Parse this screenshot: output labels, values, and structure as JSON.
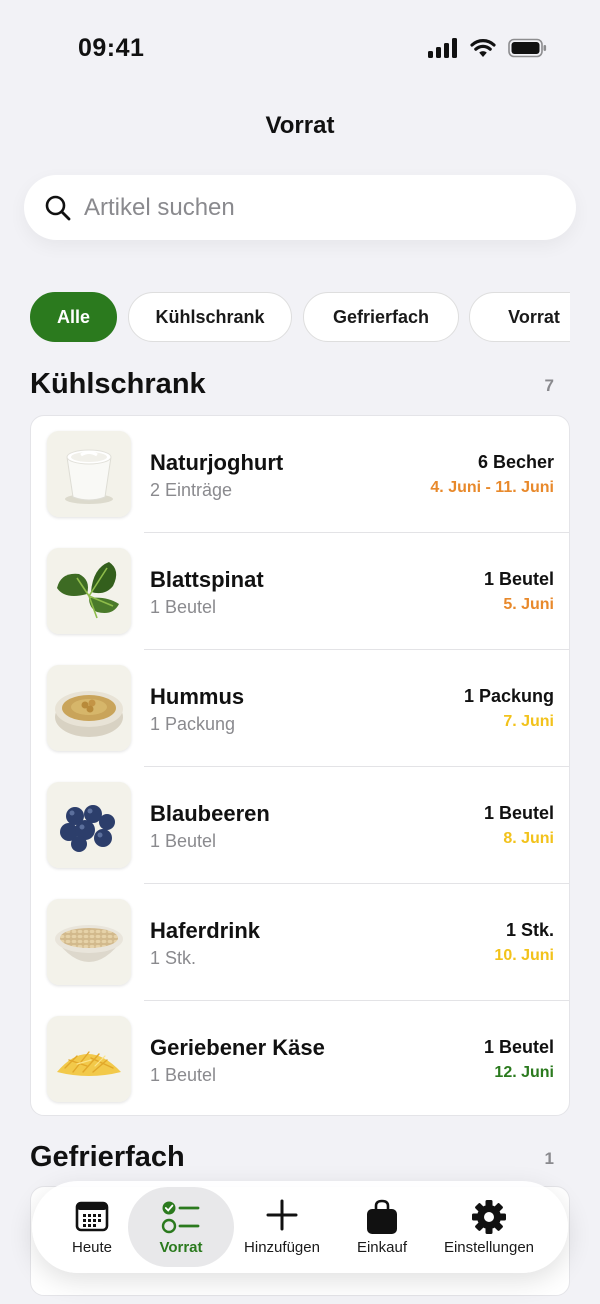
{
  "status_bar": {
    "time": "09:41"
  },
  "nav": {
    "title": "Vorrat"
  },
  "search": {
    "placeholder": "Artikel suchen"
  },
  "filters": [
    "Alle",
    "Kühlschrank",
    "Gefrierfach",
    "Vorrat"
  ],
  "sections": [
    {
      "title": "Kühlschrank",
      "count": "7",
      "items": [
        {
          "name": "Naturjoghurt",
          "sub": "2 Einträge",
          "qty": "6 Becher",
          "date": "4. Juni - 11. Juni",
          "date_color": "#e8892b",
          "image": "yogurt-image"
        },
        {
          "name": "Blattspinat",
          "sub": "1 Beutel",
          "qty": "1 Beutel",
          "date": "5. Juni",
          "date_color": "#e8892b",
          "image": "spinach-image"
        },
        {
          "name": "Hummus",
          "sub": "1 Packung",
          "qty": "1 Packung",
          "date": "7. Juni",
          "date_color": "#f2c21b",
          "image": "hummus-image"
        },
        {
          "name": "Blaubeeren",
          "sub": "1 Beutel",
          "qty": "1 Beutel",
          "date": "8. Juni",
          "date_color": "#f2c21b",
          "image": "blueberries-image"
        },
        {
          "name": "Haferdrink",
          "sub": "1 Stk.",
          "qty": "1 Stk.",
          "date": "10. Juni",
          "date_color": "#f2c21b",
          "image": "oats-image"
        },
        {
          "name": "Geriebener Käse",
          "sub": "1 Beutel",
          "qty": "1 Beutel",
          "date": "12. Juni",
          "date_color": "#2b7a1e",
          "image": "grated-cheese-image"
        }
      ]
    },
    {
      "title": "Gefrierfach",
      "count": "1"
    }
  ],
  "tabbar": {
    "items": [
      {
        "label": "Heute",
        "icon": "calendar-icon"
      },
      {
        "label": "Vorrat",
        "icon": "checklist-icon"
      },
      {
        "label": "Hinzufügen",
        "icon": "plus-icon"
      },
      {
        "label": "Einkauf",
        "icon": "shopping-bag-icon"
      },
      {
        "label": "Einstellungen",
        "icon": "gear-icon"
      }
    ],
    "active": "Vorrat"
  },
  "colors": {
    "accent": "#2b7a1e",
    "background": "#f2f2f6",
    "expiry_soon": "#e8892b",
    "expiry_mid": "#f2c21b",
    "expiry_ok": "#2b7a1e"
  }
}
